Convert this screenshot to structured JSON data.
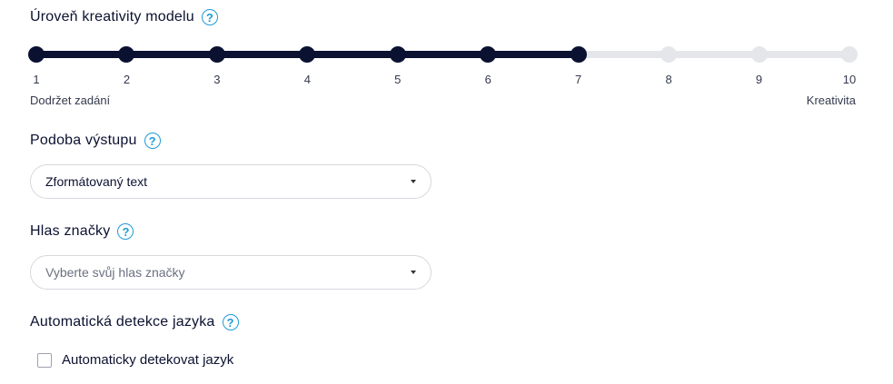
{
  "creativity": {
    "title": "Úroveň kreativity modelu",
    "value": 7,
    "min": 1,
    "max": 10,
    "ticks": [
      "1",
      "2",
      "3",
      "4",
      "5",
      "6",
      "7",
      "8",
      "9",
      "10"
    ],
    "left_label": "Dodržet zadání",
    "right_label": "Kreativita"
  },
  "output_format": {
    "title": "Podoba výstupu",
    "value": "Zformátovaný text"
  },
  "brand_voice": {
    "title": "Hlas značky",
    "placeholder": "Vyberte svůj hlas značky"
  },
  "auto_language": {
    "title": "Automatická detekce jazyka",
    "checkbox_label": "Automaticky detekovat jazyk",
    "checked": false
  },
  "icons": {
    "help": "?"
  },
  "colors": {
    "accent": "#0b1130",
    "inactive": "#e4e6ea",
    "help": "#1e9bd7"
  }
}
